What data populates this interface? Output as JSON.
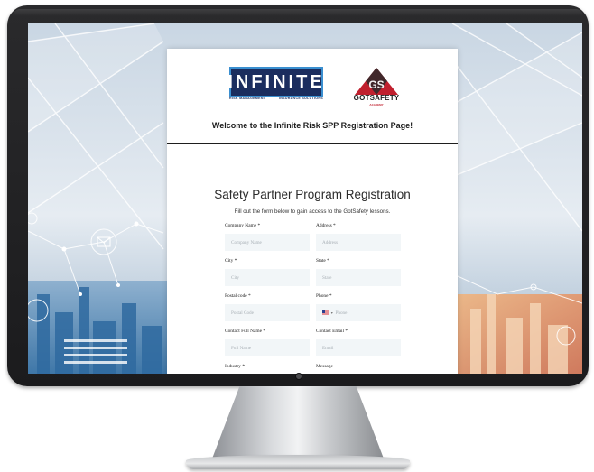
{
  "header": {
    "logo_infinite": {
      "word": "INFINITE",
      "subtitle_left": "RISK MANAGEMENT",
      "subtitle_right": "INSURANCE SOLUTIONS"
    },
    "logo_gotsafety": {
      "initials": "GS",
      "word": "GOTSAFETY",
      "tagline": "ACADEMY"
    },
    "welcome": "Welcome to the Infinite Risk SPP Registration Page!"
  },
  "form": {
    "title": "Safety Partner Program Registration",
    "subtitle": "Fill out the form below to gain access to the GotSafety lessons.",
    "fields": {
      "company_name": {
        "label": "Company Name *",
        "placeholder": "Company Name"
      },
      "address": {
        "label": "Address *",
        "placeholder": "Address"
      },
      "city": {
        "label": "City *",
        "placeholder": "City"
      },
      "state": {
        "label": "State *",
        "placeholder": "State"
      },
      "postal_code": {
        "label": "Postal code *",
        "placeholder": "Postal Code"
      },
      "phone": {
        "label": "Phone *",
        "placeholder": "Phone"
      },
      "contact_full_name": {
        "label": "Contact Full Name *",
        "placeholder": "Full Name"
      },
      "contact_email": {
        "label": "Contact Email *",
        "placeholder": "Email"
      },
      "industry": {
        "label": "Industry *"
      },
      "message": {
        "label": "Message"
      }
    }
  },
  "colors": {
    "infinite_navy": "#1b2d5e",
    "infinite_blue_border": "#3a8fd0",
    "gotsafety_red": "#c0202e",
    "input_bg": "#f2f6f8",
    "bezel": "#1b1b1d"
  },
  "icons": {
    "gotsafety_triangle": "triangle-logo-icon",
    "phone_flag": "us-flag-icon",
    "phone_caret": "chevron-down-icon"
  }
}
